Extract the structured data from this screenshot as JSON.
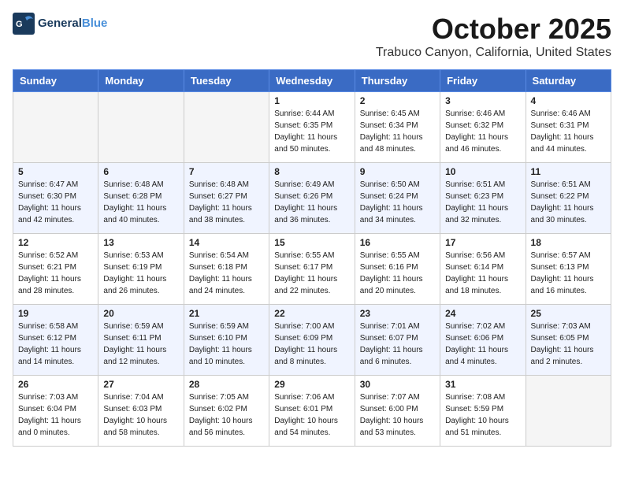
{
  "header": {
    "logo_general": "General",
    "logo_blue": "Blue",
    "month_title": "October 2025",
    "subtitle": "Trabuco Canyon, California, United States"
  },
  "weekdays": [
    "Sunday",
    "Monday",
    "Tuesday",
    "Wednesday",
    "Thursday",
    "Friday",
    "Saturday"
  ],
  "weeks": [
    [
      {
        "day": "",
        "info": ""
      },
      {
        "day": "",
        "info": ""
      },
      {
        "day": "",
        "info": ""
      },
      {
        "day": "1",
        "info": "Sunrise: 6:44 AM\nSunset: 6:35 PM\nDaylight: 11 hours\nand 50 minutes."
      },
      {
        "day": "2",
        "info": "Sunrise: 6:45 AM\nSunset: 6:34 PM\nDaylight: 11 hours\nand 48 minutes."
      },
      {
        "day": "3",
        "info": "Sunrise: 6:46 AM\nSunset: 6:32 PM\nDaylight: 11 hours\nand 46 minutes."
      },
      {
        "day": "4",
        "info": "Sunrise: 6:46 AM\nSunset: 6:31 PM\nDaylight: 11 hours\nand 44 minutes."
      }
    ],
    [
      {
        "day": "5",
        "info": "Sunrise: 6:47 AM\nSunset: 6:30 PM\nDaylight: 11 hours\nand 42 minutes."
      },
      {
        "day": "6",
        "info": "Sunrise: 6:48 AM\nSunset: 6:28 PM\nDaylight: 11 hours\nand 40 minutes."
      },
      {
        "day": "7",
        "info": "Sunrise: 6:48 AM\nSunset: 6:27 PM\nDaylight: 11 hours\nand 38 minutes."
      },
      {
        "day": "8",
        "info": "Sunrise: 6:49 AM\nSunset: 6:26 PM\nDaylight: 11 hours\nand 36 minutes."
      },
      {
        "day": "9",
        "info": "Sunrise: 6:50 AM\nSunset: 6:24 PM\nDaylight: 11 hours\nand 34 minutes."
      },
      {
        "day": "10",
        "info": "Sunrise: 6:51 AM\nSunset: 6:23 PM\nDaylight: 11 hours\nand 32 minutes."
      },
      {
        "day": "11",
        "info": "Sunrise: 6:51 AM\nSunset: 6:22 PM\nDaylight: 11 hours\nand 30 minutes."
      }
    ],
    [
      {
        "day": "12",
        "info": "Sunrise: 6:52 AM\nSunset: 6:21 PM\nDaylight: 11 hours\nand 28 minutes."
      },
      {
        "day": "13",
        "info": "Sunrise: 6:53 AM\nSunset: 6:19 PM\nDaylight: 11 hours\nand 26 minutes."
      },
      {
        "day": "14",
        "info": "Sunrise: 6:54 AM\nSunset: 6:18 PM\nDaylight: 11 hours\nand 24 minutes."
      },
      {
        "day": "15",
        "info": "Sunrise: 6:55 AM\nSunset: 6:17 PM\nDaylight: 11 hours\nand 22 minutes."
      },
      {
        "day": "16",
        "info": "Sunrise: 6:55 AM\nSunset: 6:16 PM\nDaylight: 11 hours\nand 20 minutes."
      },
      {
        "day": "17",
        "info": "Sunrise: 6:56 AM\nSunset: 6:14 PM\nDaylight: 11 hours\nand 18 minutes."
      },
      {
        "day": "18",
        "info": "Sunrise: 6:57 AM\nSunset: 6:13 PM\nDaylight: 11 hours\nand 16 minutes."
      }
    ],
    [
      {
        "day": "19",
        "info": "Sunrise: 6:58 AM\nSunset: 6:12 PM\nDaylight: 11 hours\nand 14 minutes."
      },
      {
        "day": "20",
        "info": "Sunrise: 6:59 AM\nSunset: 6:11 PM\nDaylight: 11 hours\nand 12 minutes."
      },
      {
        "day": "21",
        "info": "Sunrise: 6:59 AM\nSunset: 6:10 PM\nDaylight: 11 hours\nand 10 minutes."
      },
      {
        "day": "22",
        "info": "Sunrise: 7:00 AM\nSunset: 6:09 PM\nDaylight: 11 hours\nand 8 minutes."
      },
      {
        "day": "23",
        "info": "Sunrise: 7:01 AM\nSunset: 6:07 PM\nDaylight: 11 hours\nand 6 minutes."
      },
      {
        "day": "24",
        "info": "Sunrise: 7:02 AM\nSunset: 6:06 PM\nDaylight: 11 hours\nand 4 minutes."
      },
      {
        "day": "25",
        "info": "Sunrise: 7:03 AM\nSunset: 6:05 PM\nDaylight: 11 hours\nand 2 minutes."
      }
    ],
    [
      {
        "day": "26",
        "info": "Sunrise: 7:03 AM\nSunset: 6:04 PM\nDaylight: 11 hours\nand 0 minutes."
      },
      {
        "day": "27",
        "info": "Sunrise: 7:04 AM\nSunset: 6:03 PM\nDaylight: 10 hours\nand 58 minutes."
      },
      {
        "day": "28",
        "info": "Sunrise: 7:05 AM\nSunset: 6:02 PM\nDaylight: 10 hours\nand 56 minutes."
      },
      {
        "day": "29",
        "info": "Sunrise: 7:06 AM\nSunset: 6:01 PM\nDaylight: 10 hours\nand 54 minutes."
      },
      {
        "day": "30",
        "info": "Sunrise: 7:07 AM\nSunset: 6:00 PM\nDaylight: 10 hours\nand 53 minutes."
      },
      {
        "day": "31",
        "info": "Sunrise: 7:08 AM\nSunset: 5:59 PM\nDaylight: 10 hours\nand 51 minutes."
      },
      {
        "day": "",
        "info": ""
      }
    ]
  ]
}
